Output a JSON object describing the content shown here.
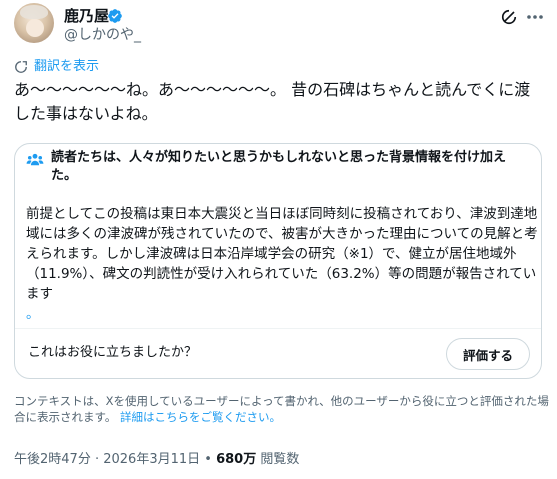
{
  "author": {
    "name": "鹿乃屋",
    "handle": "@しかのや_"
  },
  "translate_label": "翻訳を表示",
  "post_text": "あ〜〜〜〜〜〜ね。あ〜〜〜〜〜〜。 昔の石碑はちゃんと読んでくに渡した事はないよね。",
  "community_note": {
    "title": "読者たちは、人々が知りたいと思うかもしれないと思った背景情報を付け加えた。",
    "body": "前提としてこの投稿は東日本大震災と当日ほぼ同時刻に投稿されており、津波到達地域には多くの津波碑が残されていたので、被害が大きかった理由についての見解と考えられます。しかし津波碑は日本沿岸域学会の研究（※1）で、健立が居住地域外（11.9%）、碑文の判読性が受け入れられていた（63.2%）等の問題が報告されています",
    "link_char": "。",
    "helpful_question": "これはお役に立ちましたか？",
    "rate_button": "評価する"
  },
  "context_notice": {
    "text": "コンテキストは、Xを使用しているユーザーによって書かれ、他のユーザーから役に立つと評価された場合に表示されます。",
    "link": "詳細はこちらをご覧ください。"
  },
  "meta": {
    "time": "午後2時47分",
    "sep1": " · ",
    "date": "2026年3月11日",
    "sep2": " • ",
    "views_count": "680万",
    "views_label": " 閲覧数"
  },
  "colors": {
    "accent": "#1d9bf0",
    "text": "#0f1419",
    "muted": "#536471",
    "border": "#cfd9de"
  }
}
